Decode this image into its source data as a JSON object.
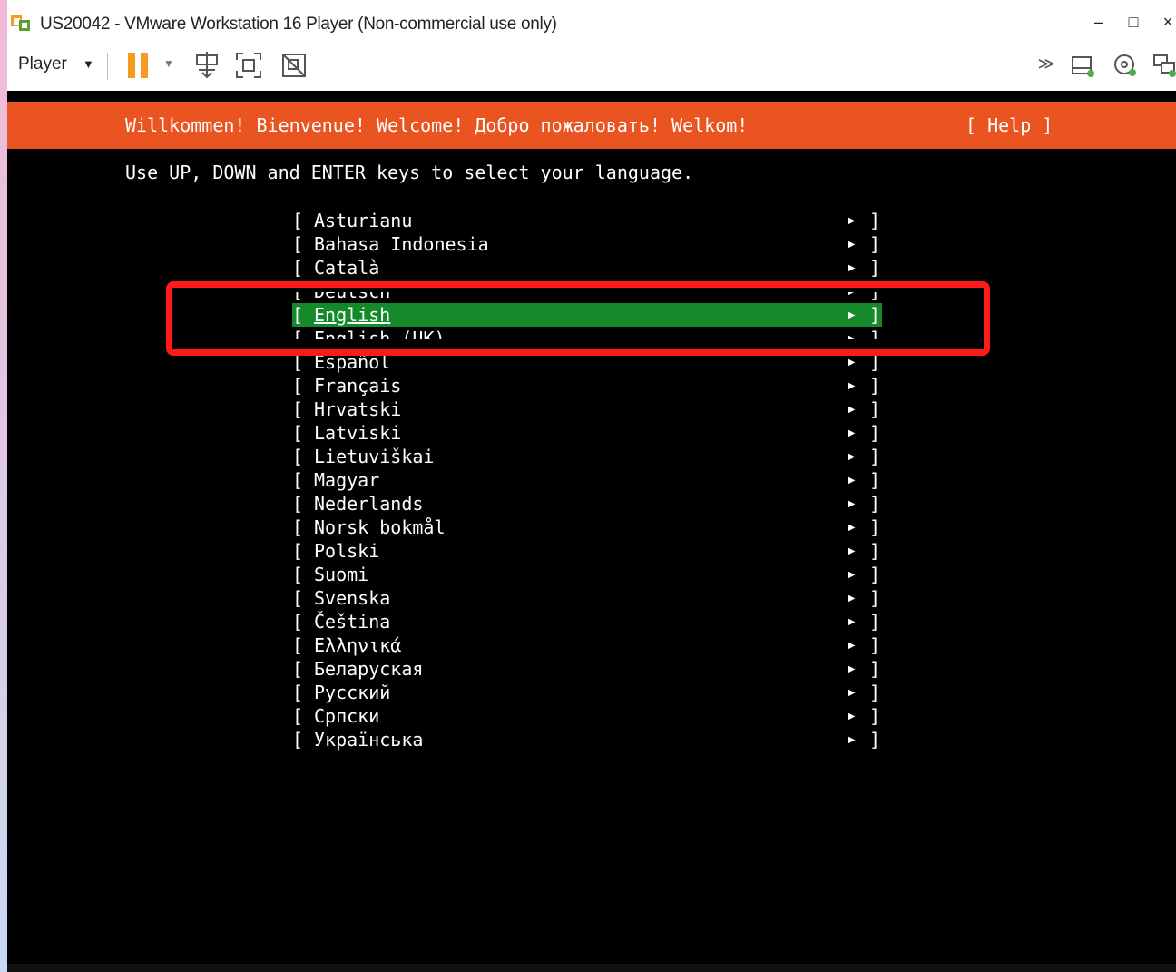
{
  "window": {
    "title": "US20042 - VMware Workstation 16 Player (Non-commercial use only)",
    "controls": [
      "–",
      "□",
      "×"
    ]
  },
  "toolbar": {
    "player_label": "Player",
    "icons": [
      "pause-icon",
      "send-ctrl-alt-del-icon",
      "fullscreen-icon",
      "unity-icon",
      "more-icon",
      "removable-device-icon",
      "cd-dvd-icon",
      "network-icon"
    ]
  },
  "installer": {
    "welcome": "Willkommen! Bienvenue! Welcome! Добро пожаловать! Welkom!",
    "help": "[ Help ]",
    "instruction": "Use UP, DOWN and ENTER keys to select your language.",
    "selected": "English",
    "languages": [
      "Asturianu",
      "Bahasa Indonesia",
      "Català",
      "Deutsch",
      "English",
      "English (UK)",
      "Español",
      "Français",
      "Hrvatski",
      "Latviski",
      "Lietuviškai",
      "Magyar",
      "Nederlands",
      "Norsk bokmål",
      "Polski",
      "Suomi",
      "Svenska",
      "Čeština",
      "Ελληνικά",
      "Беларуская",
      "Русский",
      "Српски",
      "Українська"
    ],
    "bracket_open": "[",
    "bracket_close": "]",
    "arrow": "▶"
  },
  "colors": {
    "header_orange": "#e95420",
    "selection_green": "#148a2b",
    "annotation_red": "#ff1a1a",
    "pause_orange": "#f39c1f"
  }
}
